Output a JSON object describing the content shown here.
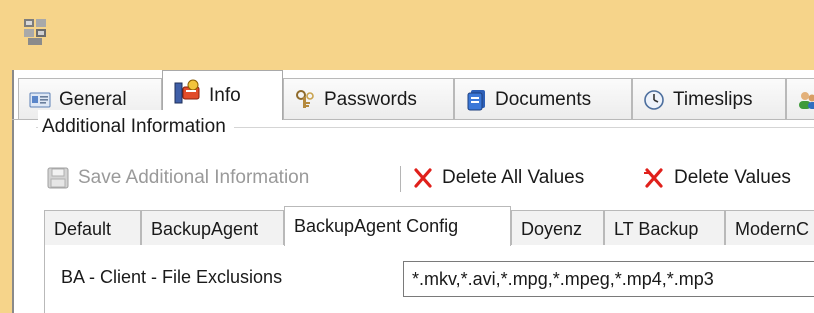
{
  "window": {
    "icon": "app-icon"
  },
  "main_tabs": [
    {
      "label": "General",
      "icon": "general-card-icon"
    },
    {
      "label": "Info",
      "icon": "info-icon"
    },
    {
      "label": "Passwords",
      "icon": "keys-icon"
    },
    {
      "label": "Documents",
      "icon": "documents-icon"
    },
    {
      "label": "Timeslips",
      "icon": "clock-icon"
    },
    {
      "label": "",
      "icon": "users-icon"
    }
  ],
  "group": {
    "label": "Additional Information"
  },
  "toolbar": {
    "save_label": "Save Additional Information",
    "delete_all_label": "Delete All Values",
    "delete_values_label": "Delete Values",
    "colors": {
      "delete": "#e0201b",
      "disabled": "#9a9a9a"
    }
  },
  "sub_tabs": [
    {
      "label": "Default"
    },
    {
      "label": "BackupAgent"
    },
    {
      "label": "BackupAgent Config"
    },
    {
      "label": "Doyenz"
    },
    {
      "label": "LT Backup"
    },
    {
      "label": "ModernC"
    }
  ],
  "property": {
    "label": "BA - Client - File Exclusions",
    "value": "*.mkv,*.avi,*.mpg,*.mpeg,*.mp4,*.mp3"
  },
  "colors": {
    "titlebar": "#f6d48a",
    "tab_border": "#b9b9b9"
  }
}
